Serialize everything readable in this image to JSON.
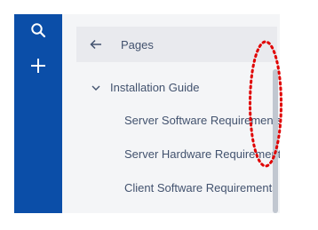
{
  "rail": {
    "icons": [
      "search-icon",
      "plus-icon"
    ],
    "color": "#0b4ea8"
  },
  "sidebar": {
    "header": {
      "back_icon": "arrow-left-icon",
      "label": "Pages"
    },
    "tree": [
      {
        "label": "Installation Guide",
        "expanded": true,
        "icon": "chevron-down-icon"
      },
      {
        "label": "Server Software Requirements"
      },
      {
        "label": "Server Hardware Requirements"
      },
      {
        "label": "Client Software Requirements"
      }
    ]
  },
  "annotation": {
    "shape": "dotted-ellipse",
    "color": "#e00000"
  }
}
